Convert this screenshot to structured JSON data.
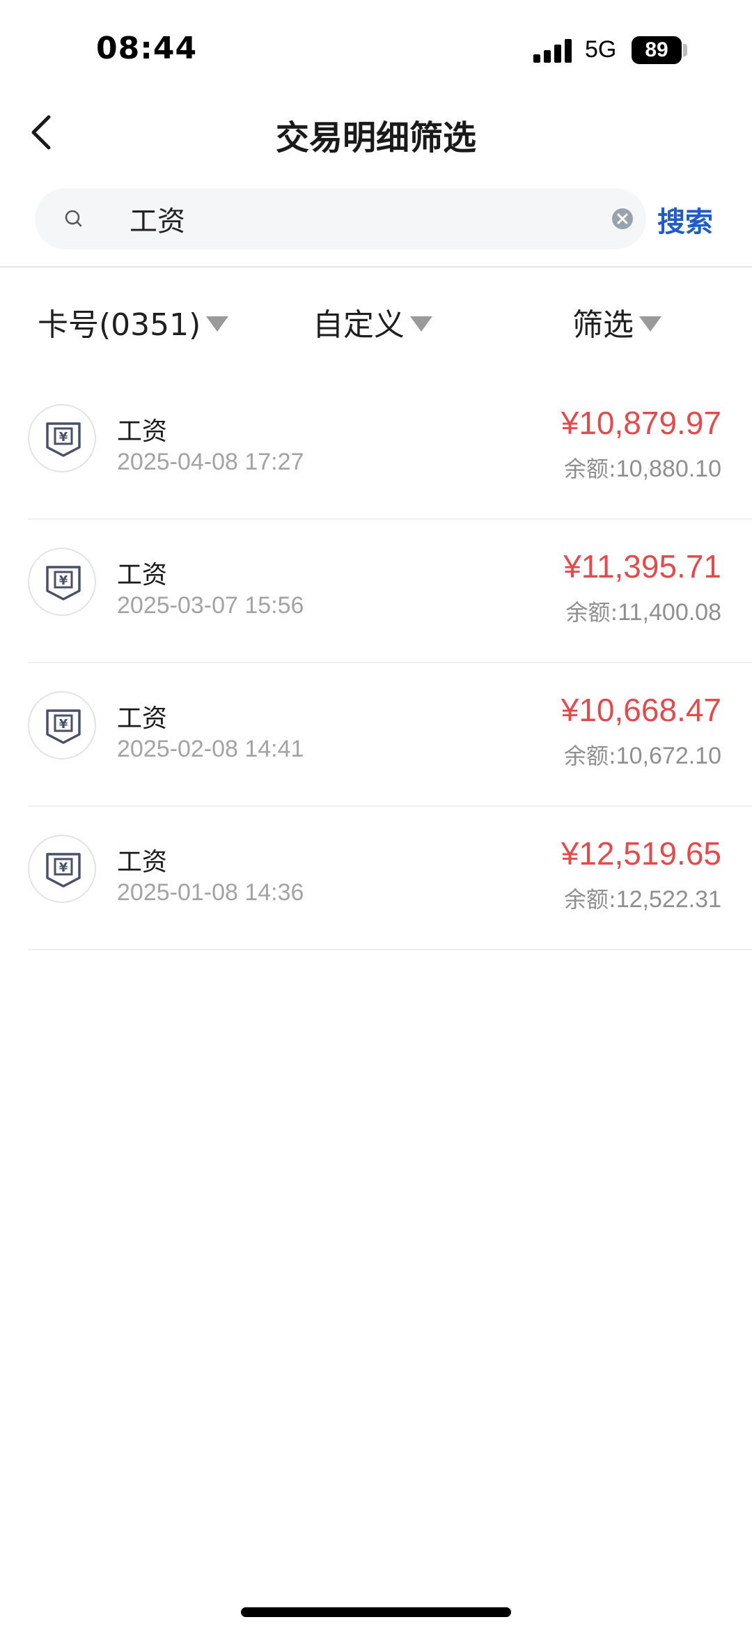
{
  "status_bar": {
    "time": "08:44",
    "network": "5G",
    "battery": "89"
  },
  "nav": {
    "title": "交易明细筛选",
    "back_icon": "chevron-left-icon"
  },
  "search": {
    "value": "工资",
    "placeholder": "",
    "button_label": "搜索"
  },
  "filters": {
    "card_label": "卡号(0351)",
    "custom_label": "自定义",
    "screen_label": "筛选"
  },
  "transactions": [
    {
      "title": "工资",
      "time": "2025-04-08 17:27",
      "amount": "¥10,879.97",
      "balance_label": "余额:",
      "balance": "10,880.10"
    },
    {
      "title": "工资",
      "time": "2025-03-07 15:56",
      "amount": "¥11,395.71",
      "balance_label": "余额:",
      "balance": "11,400.08"
    },
    {
      "title": "工资",
      "time": "2025-02-08 14:41",
      "amount": "¥10,668.47",
      "balance_label": "余额:",
      "balance": "10,672.10"
    },
    {
      "title": "工资",
      "time": "2025-01-08 14:36",
      "amount": "¥12,519.65",
      "balance_label": "余额:",
      "balance": "12,522.31"
    }
  ],
  "colors": {
    "amount": "#e24b4b",
    "accent": "#1f5cc4",
    "secondary_text": "#a3a3a3"
  }
}
